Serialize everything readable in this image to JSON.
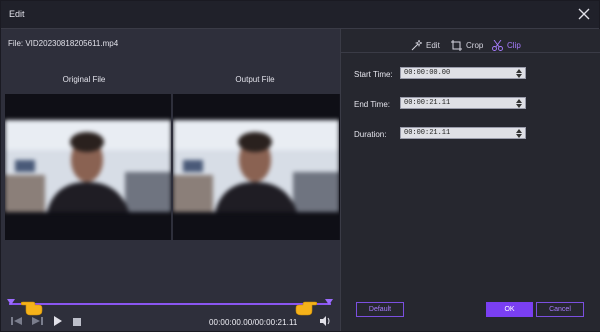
{
  "window": {
    "title": "Edit"
  },
  "left": {
    "file_label": "File: VID20230818205611.mp4",
    "original_label": "Original File",
    "output_label": "Output File",
    "time_readout": "00:00:00.00/00:00:21.11"
  },
  "tabs": [
    {
      "label": "Edit",
      "icon": "magic-wand-icon"
    },
    {
      "label": "Crop",
      "icon": "crop-icon"
    },
    {
      "label": "Clip",
      "icon": "scissors-icon",
      "active": true
    }
  ],
  "clip": {
    "start_label": "Start Time:",
    "start_value": "00:00:00.00",
    "end_label": "End Time:",
    "end_value": "00:00:21.11",
    "duration_label": "Duration:",
    "duration_value": "00:00:21.11"
  },
  "buttons": {
    "default": "Default",
    "ok": "OK",
    "cancel": "Cancel"
  },
  "colors": {
    "accent": "#7a3ff2",
    "accent_light": "#a87cff",
    "panel": "#2e2f3b"
  }
}
